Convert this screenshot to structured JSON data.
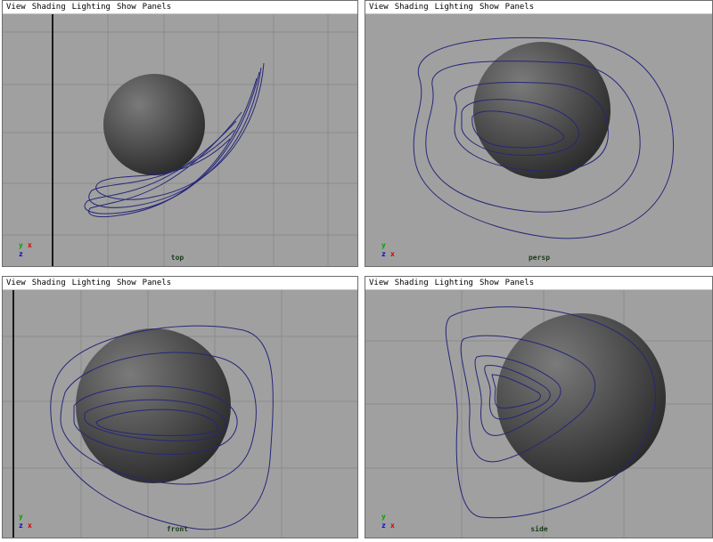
{
  "menu": [
    "View",
    "Shading",
    "Lighting",
    "Show",
    "Panels"
  ],
  "colors": {
    "viewport_bg": "#a0a0a0",
    "grid_line": "#8c8c8c",
    "curve": "#26267a",
    "axis_x": "#d00000",
    "axis_y": "#00a000",
    "axis_z": "#0000d0"
  },
  "viewports": [
    {
      "name": "top",
      "label": "top",
      "axes": [
        "y",
        "x",
        "z"
      ]
    },
    {
      "name": "persp",
      "label": "persp",
      "axes": [
        "y",
        "x",
        "z"
      ]
    },
    {
      "name": "front",
      "label": "front",
      "axes": [
        "y",
        "x",
        "z"
      ]
    },
    {
      "name": "side",
      "label": "side",
      "axes": [
        "y",
        "x",
        "z"
      ]
    }
  ]
}
